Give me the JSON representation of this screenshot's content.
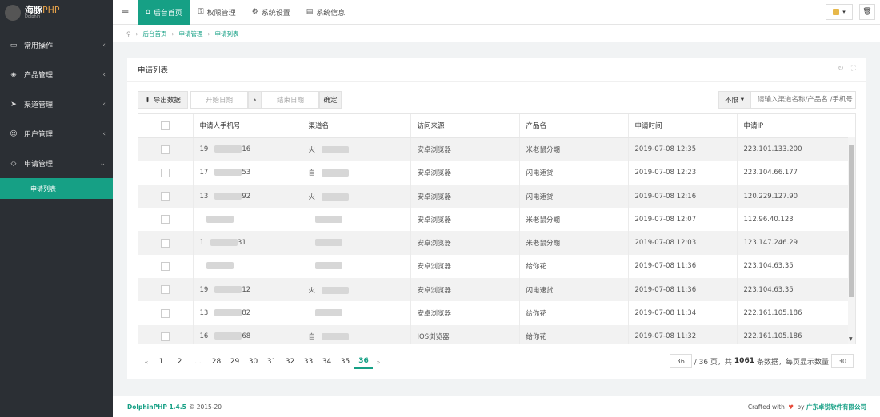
{
  "brand": {
    "name": "海豚",
    "name_suffix": "PHP",
    "sub": "Dolphin"
  },
  "sidebar": {
    "items": [
      {
        "label": "常用操作",
        "icon": "folder-icon"
      },
      {
        "label": "产品管理",
        "icon": "cubes-icon"
      },
      {
        "label": "渠道管理",
        "icon": "send-icon"
      },
      {
        "label": "用户管理",
        "icon": "user-icon"
      },
      {
        "label": "申请管理",
        "icon": "tag-icon"
      }
    ],
    "subitem": "申请列表"
  },
  "topbar": {
    "tabs": [
      {
        "label": "后台首页",
        "active": true
      },
      {
        "label": "权限管理"
      },
      {
        "label": "系统设置"
      },
      {
        "label": "系统信息"
      }
    ]
  },
  "breadcrumb": [
    "后台首页",
    "申请管理",
    "申请列表"
  ],
  "panel": {
    "title": "申请列表"
  },
  "toolbar": {
    "export_label": "导出数据",
    "start_placeholder": "开始日期",
    "end_placeholder": "结束日期",
    "confirm_label": "确定",
    "filter_label": "不限",
    "search_placeholder": "请输入渠道名称/产品名 /手机号"
  },
  "table": {
    "headers": [
      "申请人手机号",
      "渠道名",
      "访问来源",
      "产品名",
      "申请时间",
      "申请IP"
    ],
    "rows": [
      {
        "phone": "19",
        "phone_end": "16",
        "channel": "火",
        "source": "安卓浏览器",
        "product": "米老鼠分期",
        "time": "2019-07-08 12:35",
        "ip": "223.101.133.200"
      },
      {
        "phone": "17",
        "phone_end": "53",
        "channel": "自",
        "source": "安卓浏览器",
        "product": "闪电速贷",
        "time": "2019-07-08 12:23",
        "ip": "223.104.66.177"
      },
      {
        "phone": "13",
        "phone_end": "92",
        "channel": "火",
        "source": "安卓浏览器",
        "product": "闪电速贷",
        "time": "2019-07-08 12:16",
        "ip": "120.229.127.90"
      },
      {
        "phone": "",
        "phone_end": "",
        "channel": "",
        "source": "安卓浏览器",
        "product": "米老鼠分期",
        "time": "2019-07-08 12:07",
        "ip": "112.96.40.123"
      },
      {
        "phone": "1",
        "phone_end": "31",
        "channel": "",
        "source": "安卓浏览器",
        "product": "米老鼠分期",
        "time": "2019-07-08 12:03",
        "ip": "123.147.246.29"
      },
      {
        "phone": "",
        "phone_end": "",
        "channel": "",
        "source": "安卓浏览器",
        "product": "给你花",
        "time": "2019-07-08 11:36",
        "ip": "223.104.63.35"
      },
      {
        "phone": "19",
        "phone_end": "12",
        "channel": "火",
        "source": "安卓浏览器",
        "product": "闪电速贷",
        "time": "2019-07-08 11:36",
        "ip": "223.104.63.35"
      },
      {
        "phone": "13",
        "phone_end": "82",
        "channel": "",
        "source": "安卓浏览器",
        "product": "给你花",
        "time": "2019-07-08 11:34",
        "ip": "222.161.105.186"
      },
      {
        "phone": "16",
        "phone_end": "68",
        "channel": "自",
        "source": "IOS浏览器",
        "product": "给你花",
        "time": "2019-07-08 11:32",
        "ip": "222.161.105.186"
      }
    ]
  },
  "pagination": {
    "prev": "«",
    "pages": [
      "1",
      "2",
      "...",
      "28",
      "29",
      "30",
      "31",
      "32",
      "33",
      "34",
      "35",
      "36"
    ],
    "active": "36",
    "next": "»",
    "current_page": "36",
    "total_pages_text": "/ 36 页，共",
    "total_count": "1061",
    "count_suffix": "条数据，每页显示数量",
    "per_page": "30"
  },
  "footer": {
    "brand": "DolphinPHP 1.4.5",
    "copyright": "© 2015-20",
    "crafted": "Crafted with",
    "by": "by",
    "company": "广东卓锐软件有限公司"
  }
}
